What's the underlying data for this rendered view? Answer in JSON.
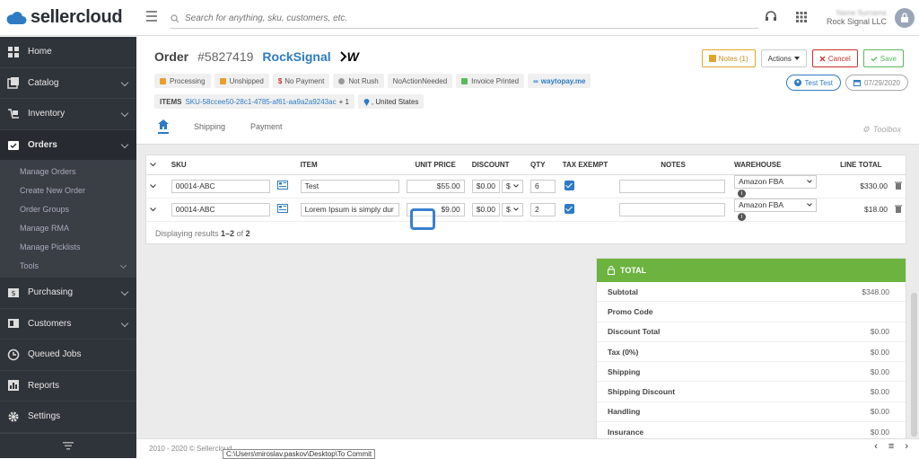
{
  "app": {
    "brand": "sellercloud"
  },
  "search": {
    "placeholder": "Search for anything, sku, customers, etc."
  },
  "user": {
    "name": "Name Surname",
    "org": "Rock Signal LLC",
    "avatar_color": "#9aa6b8"
  },
  "sidebar": {
    "items": [
      {
        "label": "Home",
        "icon": "home-icon"
      },
      {
        "label": "Catalog",
        "icon": "catalog-icon"
      },
      {
        "label": "Inventory",
        "icon": "inventory-icon"
      },
      {
        "label": "Orders",
        "icon": "orders-icon"
      },
      {
        "label": "Purchasing",
        "icon": "purchasing-icon"
      },
      {
        "label": "Customers",
        "icon": "customers-icon"
      },
      {
        "label": "Queued Jobs",
        "icon": "clock-icon"
      },
      {
        "label": "Reports",
        "icon": "reports-icon"
      },
      {
        "label": "Settings",
        "icon": "gear-icon"
      }
    ],
    "orders_sub": [
      "Manage Orders",
      "Create New Order",
      "Order Groups",
      "Manage RMA",
      "Manage Picklists",
      "Tools"
    ],
    "bg_color": "#2f333a"
  },
  "order": {
    "label": "Order",
    "number": "#5827419",
    "company": "RockSignal",
    "channel_logo": "W",
    "badges": [
      "Processing",
      "Unshipped",
      "No Payment",
      "Not Rush",
      "NoActionNeeded",
      "Invoice Printed",
      "waytopay.me"
    ],
    "items_label": "ITEMS",
    "items_sku": "SKU-58ccee50-28c1-4785-af61-aa9a2a9243ac",
    "items_more": "+ 1",
    "country": ", United States",
    "customer": "Test Test",
    "date": "07/29/2020"
  },
  "actions": {
    "notes": "Notes (1)",
    "actions": "Actions",
    "cancel": "Cancel",
    "save": "Save"
  },
  "tabs": {
    "shipping": "Shipping",
    "payment": "Payment",
    "toolbox": "Toolbox"
  },
  "table": {
    "headers": [
      "SKU",
      "ITEM",
      "UNIT PRICE",
      "DISCOUNT",
      "QTY",
      "TAX EXEMPT",
      "NOTES",
      "WAREHOUSE",
      "LINE TOTAL"
    ],
    "rows": [
      {
        "sku": "00014-ABC",
        "item": "Test",
        "unit_price": "$55.00",
        "discount": "$0.00",
        "disc_type": "$",
        "qty": "6",
        "tax_exempt": true,
        "notes": "",
        "warehouse": "Amazon FBA",
        "line_total": "$330.00"
      },
      {
        "sku": "00014-ABC",
        "item": "Lorem Ipsum is simply dur",
        "unit_price": "$9.00",
        "discount": "$0.00",
        "disc_type": "$",
        "qty": "2",
        "tax_exempt": true,
        "notes": "",
        "warehouse": "Amazon FBA",
        "line_total": "$18.00"
      }
    ],
    "results_prefix": "Displaying results",
    "results_range": "1–2",
    "results_of": "of",
    "results_total": "2"
  },
  "totals": {
    "title": "TOTAL",
    "header_color": "#6cb33f",
    "rows": [
      {
        "label": "Subtotal",
        "value": "$348.00"
      },
      {
        "label": "Promo Code",
        "value": ""
      },
      {
        "label": "Discount Total",
        "value": "$0.00"
      },
      {
        "label": "Tax (0%)",
        "value": "$0.00"
      },
      {
        "label": "Shipping",
        "value": "$0.00"
      },
      {
        "label": "Shipping Discount",
        "value": "$0.00"
      },
      {
        "label": "Handling",
        "value": "$0.00"
      },
      {
        "label": "Insurance",
        "value": "$0.00"
      }
    ]
  },
  "footer": {
    "copyright": "2010 - 2020 © Sellercloud",
    "tooltip": "C:\\Users\\miroslav.paskov\\Desktop\\To Commit"
  },
  "colors": {
    "accent": "#2e7bc4",
    "highlight": "#3a7fd0"
  }
}
